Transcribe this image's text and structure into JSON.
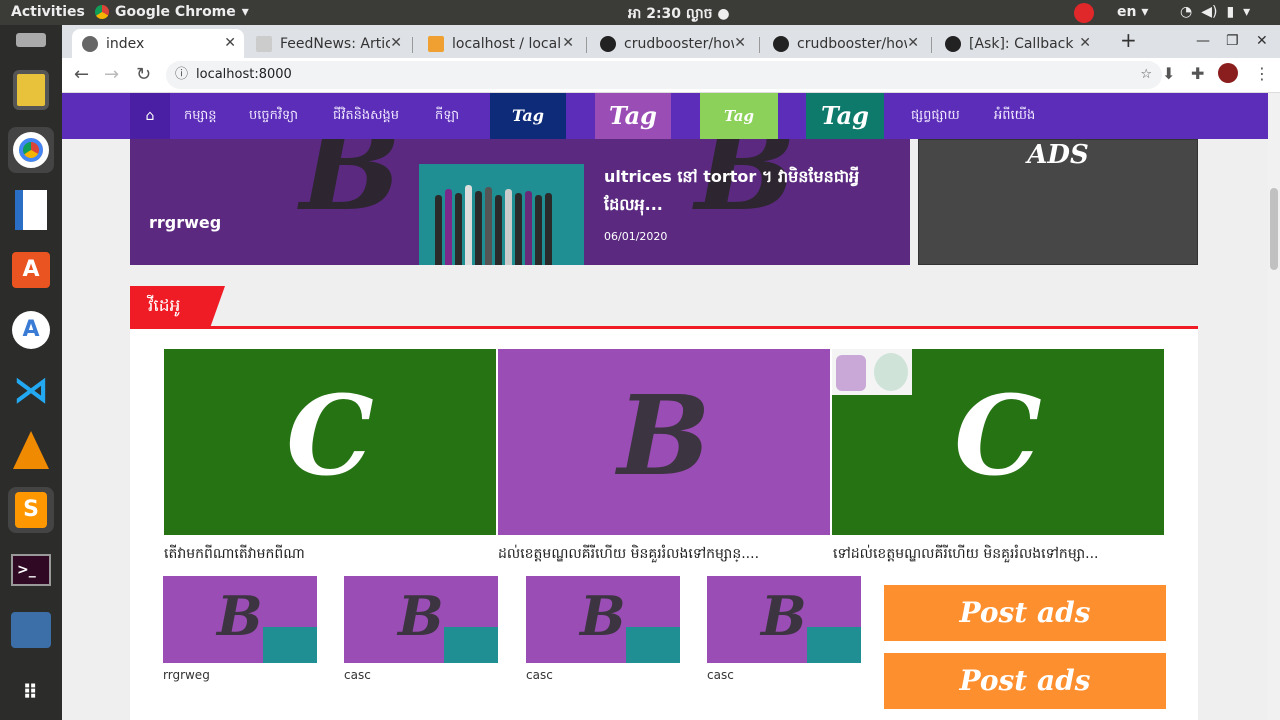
{
  "system_bar": {
    "activities": "Activities",
    "app_name": "Google Chrome",
    "clock": "អា 2:30 ល្ងាច ●",
    "language": "en"
  },
  "browser": {
    "tabs": [
      {
        "title": "index",
        "active": true
      },
      {
        "title": "FeedNews: Article"
      },
      {
        "title": "localhost / localhost"
      },
      {
        "title": "crudbooster/how"
      },
      {
        "title": "crudbooster/how"
      },
      {
        "title": "[Ask]: Callback PHP"
      }
    ],
    "new_tab": "+",
    "url": "localhost:8000"
  },
  "site": {
    "nav_items": [
      "កម្សាន្ត",
      "បច្ចេកវិទ្យា",
      "ជីវិតនិងសង្គម",
      "កីឡា"
    ],
    "tags": [
      {
        "label": "Tag",
        "color": "#0e2b7a"
      },
      {
        "label": "Tag",
        "color": "#9b4db6"
      },
      {
        "label": "Tag",
        "color": "#8bd15a"
      },
      {
        "label": "Tag",
        "color": "#0d7a6b"
      }
    ],
    "nav_items_right": [
      "ផ្សព្វផ្សាយ",
      "អំពីយើង"
    ],
    "hero": {
      "name": "rrgrweg",
      "title": "ultrices នៅ tortor ។ វាមិនមែនជាអ្វីដែលអុ...",
      "date": "06/01/2020"
    },
    "side_ads": "ADS",
    "section_title": "វីដេអូ",
    "featured": [
      {
        "letter": "C",
        "bg": "#267314",
        "color": "#ffffff",
        "caption": "តើវាមកពីណាតើវាមកពីណា"
      },
      {
        "letter": "B",
        "bg": "#9b4db6",
        "color": "#3c3440",
        "caption": "ដល់ខេត្តមណ្ឌលគីរីហើយ មិនគួររំលងទៅកម្សាន្...."
      },
      {
        "letter": "C",
        "bg": "#267314",
        "color": "#ffffff",
        "caption": "ទៅដល់ខេត្តមណ្ឌលគីរីហើយ មិនគួររំលងទៅកម្សា..."
      }
    ],
    "small_items": [
      {
        "letter": "B",
        "caption": "rrgrweg"
      },
      {
        "letter": "B",
        "caption": "casc"
      },
      {
        "letter": "B",
        "caption": "casc"
      },
      {
        "letter": "B",
        "caption": "casc"
      }
    ],
    "post_ads": [
      "Post ads",
      "Post ads"
    ]
  }
}
